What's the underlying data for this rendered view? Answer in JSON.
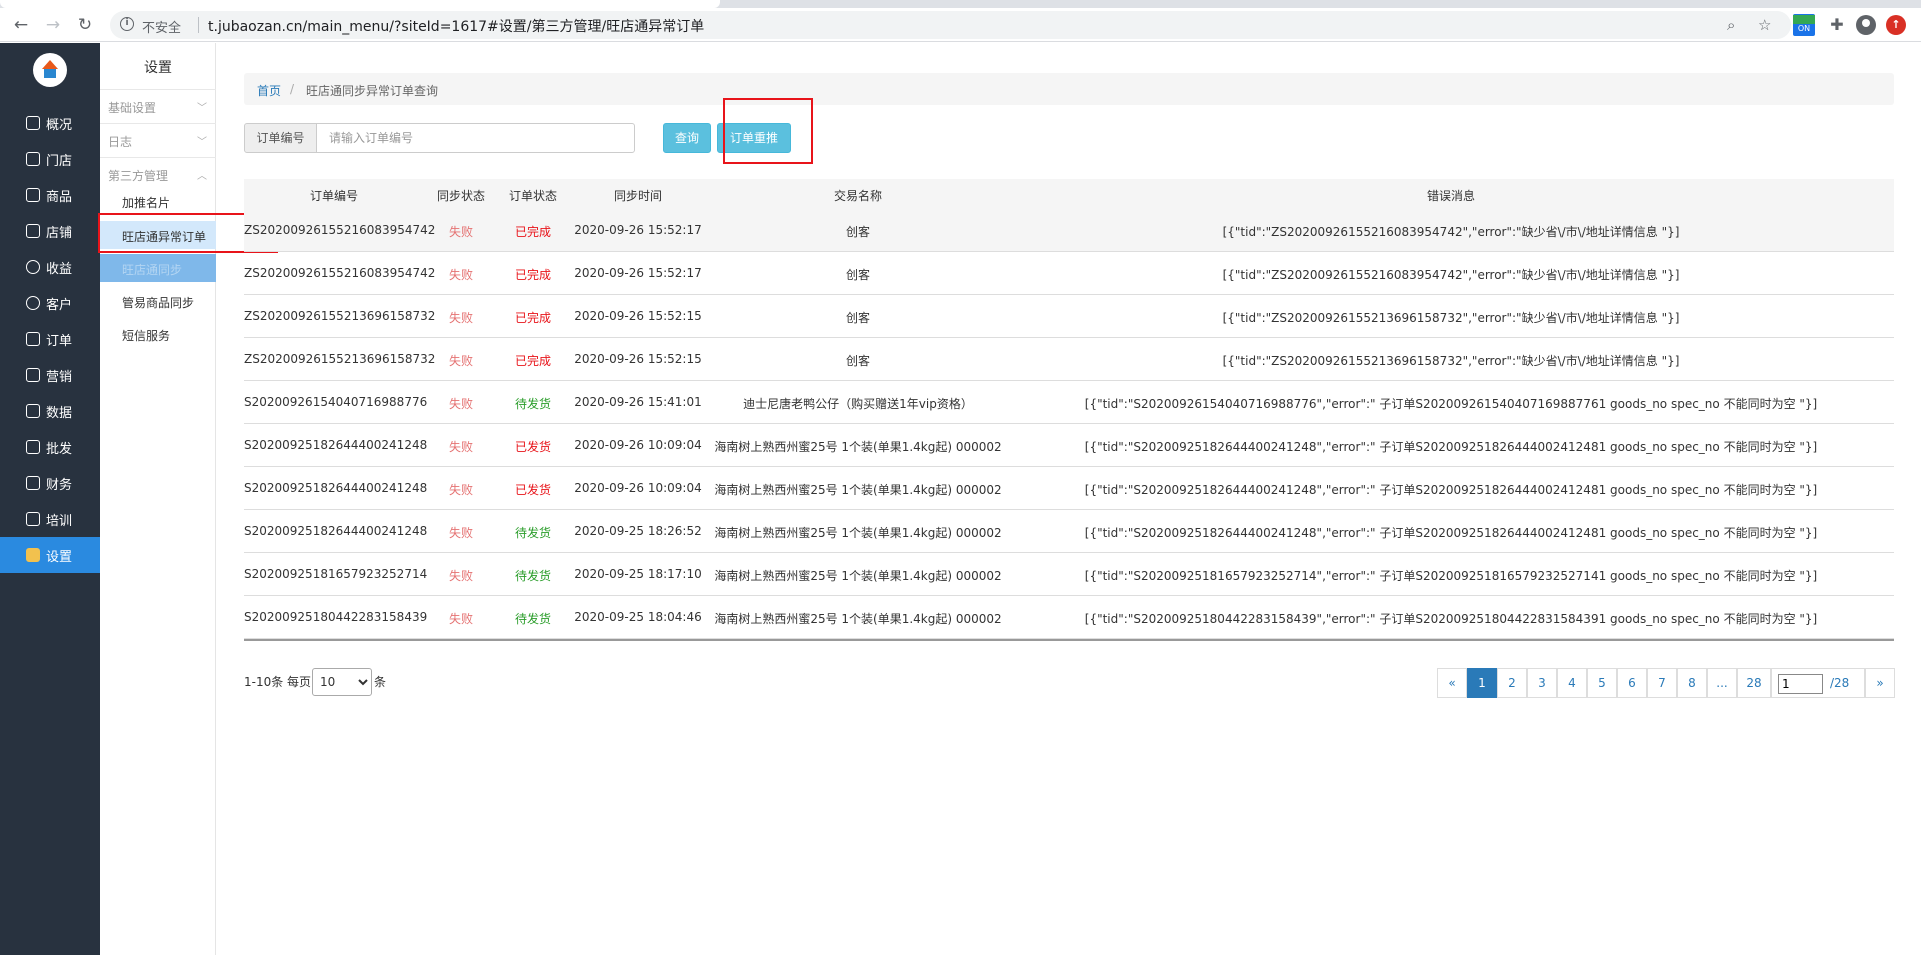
{
  "browser": {
    "insecure_label": "不安全",
    "url": "t.jubaozan.cn/main_menu/?siteId=1617#设置/第三方管理/旺店通异常订单",
    "ext_badge": "ON"
  },
  "sidebar": {
    "items": [
      {
        "label": "概况"
      },
      {
        "label": "门店"
      },
      {
        "label": "商品"
      },
      {
        "label": "店铺"
      },
      {
        "label": "收益"
      },
      {
        "label": "客户"
      },
      {
        "label": "订单"
      },
      {
        "label": "营销"
      },
      {
        "label": "数据"
      },
      {
        "label": "批发"
      },
      {
        "label": "财务"
      },
      {
        "label": "培训"
      },
      {
        "label": "设置"
      }
    ]
  },
  "subnav": {
    "title": "设置",
    "groups": [
      "基础设置",
      "日志",
      "第三方管理"
    ],
    "items": [
      "加推名片",
      "旺店通异常订单",
      "旺店通同步",
      "管易商品同步",
      "短信服务"
    ]
  },
  "breadcrumb": {
    "home": "首页",
    "separator": "/",
    "current": "旺店通同步异常订单查询"
  },
  "search": {
    "label": "订单编号",
    "placeholder": "请输入订单编号",
    "query_button": "查询",
    "retry_button": "订单重推"
  },
  "table": {
    "headers": [
      "订单编号",
      "同步状态",
      "订单状态",
      "同步时间",
      "交易名称",
      "错误消息"
    ],
    "rows": [
      {
        "order_no": "ZS2020092615521608395474​2",
        "sync_status": "失败",
        "order_status": "已完成",
        "sync_time": "2020-09-26 15:52:17",
        "trade_name": "创客",
        "error": "[{\"tid\":\"ZS20200926155216083954742\",\"error\":\"缺少省\\/市\\/地址详情信息 \"}]"
      },
      {
        "order_no": "ZS20200926155216083954742",
        "sync_status": "失败",
        "order_status": "已完成",
        "sync_time": "2020-09-26 15:52:17",
        "trade_name": "创客",
        "error": "[{\"tid\":\"ZS20200926155216083954742\",\"error\":\"缺少省\\/市\\/地址详情信息 \"}]"
      },
      {
        "order_no": "ZS20200926155213696158732",
        "sync_status": "失败",
        "order_status": "已完成",
        "sync_time": "2020-09-26 15:52:15",
        "trade_name": "创客",
        "error": "[{\"tid\":\"ZS20200926155213696158732\",\"error\":\"缺少省\\/市\\/地址详情信息 \"}]"
      },
      {
        "order_no": "ZS20200926155213696158732",
        "sync_status": "失败",
        "order_status": "已完成",
        "sync_time": "2020-09-26 15:52:15",
        "trade_name": "创客",
        "error": "[{\"tid\":\"ZS20200926155213696158732\",\"error\":\"缺少省\\/市\\/地址详情信息 \"}]"
      },
      {
        "order_no": "S20200926154040716988776",
        "sync_status": "失败",
        "order_status": "待发货",
        "sync_time": "2020-09-26 15:41:01",
        "trade_name": "迪士尼唐老鸭公仔（购买赠送1年vip资格）",
        "error": "[{\"tid\":\"S20200926154040716988776\",\"error\":\" 子订单S202009261540407169887761 goods_no spec_no 不能同时为空 \"}]"
      },
      {
        "order_no": "S20200925182644400241248",
        "sync_status": "失败",
        "order_status": "已发货",
        "sync_time": "2020-09-26 10:09:04",
        "trade_name": "海南树上熟西州蜜25号 1个装(单果1.4kg起) 000002",
        "error": "[{\"tid\":\"S20200925182644400241248\",\"error\":\" 子订单S202009251826444002412481 goods_no spec_no 不能同时为空 \"}]"
      },
      {
        "order_no": "S20200925182644400241248",
        "sync_status": "失败",
        "order_status": "已发货",
        "sync_time": "2020-09-26 10:09:04",
        "trade_name": "海南树上熟西州蜜25号 1个装(单果1.4kg起) 000002",
        "error": "[{\"tid\":\"S20200925182644400241248\",\"error\":\" 子订单S202009251826444002412481 goods_no spec_no 不能同时为空 \"}]"
      },
      {
        "order_no": "S20200925182644400241248",
        "sync_status": "失败",
        "order_status": "待发货",
        "sync_time": "2020-09-25 18:26:52",
        "trade_name": "海南树上熟西州蜜25号 1个装(单果1.4kg起) 000002",
        "error": "[{\"tid\":\"S20200925182644400241248\",\"error\":\" 子订单S202009251826444002412481 goods_no spec_no 不能同时为空 \"}]"
      },
      {
        "order_no": "S20200925181657923252714",
        "sync_status": "失败",
        "order_status": "待发货",
        "sync_time": "2020-09-25 18:17:10",
        "trade_name": "海南树上熟西州蜜25号 1个装(单果1.4kg起) 000002",
        "error": "[{\"tid\":\"S20200925181657923252714\",\"error\":\" 子订单S202009251816579232527141 goods_no spec_no 不能同时为空 \"}]"
      },
      {
        "order_no": "S20200925180442283158439",
        "sync_status": "失败",
        "order_status": "待发货",
        "sync_time": "2020-09-25 18:04:46",
        "trade_name": "海南树上熟西州蜜25号 1个装(单果1.4kg起) 000002",
        "error": "[{\"tid\":\"S20200925180442283158439\",\"error\":\" 子订单S202009251804422831584391 goods_no spec_no 不能同时为空 \"}]"
      }
    ]
  },
  "pagination": {
    "summary": "1-10条 每页",
    "page_size": "10",
    "suffix": "条",
    "prev": "«",
    "pages": [
      "1",
      "2",
      "3",
      "4",
      "5",
      "6",
      "7",
      "8",
      "...",
      "28"
    ],
    "current_input": "1",
    "total": "/28",
    "next": "»"
  },
  "colors": {
    "sidebar_bg": "#28323f",
    "sidebar_active": "#2a8ae0",
    "fail": "#e57373",
    "completed": "#e8141a",
    "pending": "#2a9d2a",
    "button": "#5bc0de",
    "highlight_box": "#e8141a"
  }
}
